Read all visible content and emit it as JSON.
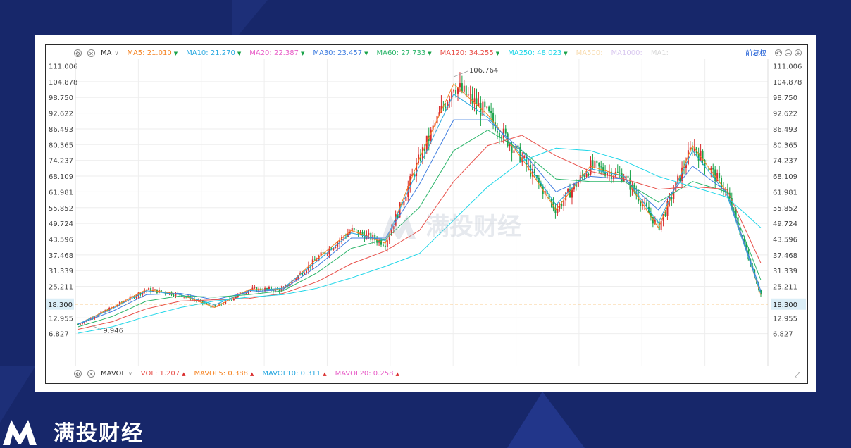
{
  "brand": {
    "name": "满投财经",
    "watermark": "满投财经"
  },
  "colors": {
    "background": "#17276a",
    "up": "#d92d2d",
    "down": "#1aa34a",
    "ref_line": "#f59a23"
  },
  "top_toolbar": {
    "settings_icon": "gear-icon",
    "close_icon": "close-icon",
    "indicator": "MA",
    "items": [
      {
        "name": "MA5:",
        "value": "21.010",
        "dir": "down",
        "color": "#f58220"
      },
      {
        "name": "MA10:",
        "value": "21.270",
        "dir": "down",
        "color": "#29a8e0"
      },
      {
        "name": "MA20:",
        "value": "22.387",
        "dir": "down",
        "color": "#e85fc8"
      },
      {
        "name": "MA30:",
        "value": "23.457",
        "dir": "down",
        "color": "#3f7de0"
      },
      {
        "name": "MA60:",
        "value": "27.733",
        "dir": "down",
        "color": "#2bb56a"
      },
      {
        "name": "MA120:",
        "value": "34.255",
        "dir": "down",
        "color": "#e8504a"
      },
      {
        "name": "MA250:",
        "value": "48.023",
        "dir": "down",
        "color": "#1fd6e8"
      },
      {
        "name": "MA500:",
        "value": "",
        "dir": "",
        "color": "#f8dcb0"
      },
      {
        "name": "MA1000:",
        "value": "",
        "dir": "",
        "color": "#d9c8f0"
      },
      {
        "name": "MA1:",
        "value": "",
        "dir": "",
        "color": "#d8d8d8"
      }
    ],
    "adjust_label": "前复权"
  },
  "bottom_toolbar": {
    "settings_icon": "gear-icon",
    "close_icon": "close-icon",
    "indicator": "MAVOL",
    "items": [
      {
        "name": "VOL:",
        "value": "1.207",
        "dir": "up",
        "color": "#e8504a"
      },
      {
        "name": "MAVOL5:",
        "value": "0.388",
        "dir": "up",
        "color": "#f58220"
      },
      {
        "name": "MAVOL10:",
        "value": "0.311",
        "dir": "up",
        "color": "#29a8e0"
      },
      {
        "name": "MAVOL20:",
        "value": "0.258",
        "dir": "up",
        "color": "#e85fc8"
      }
    ]
  },
  "chart_data": {
    "type": "line",
    "title": "",
    "xlabel": "",
    "ylabel": "",
    "ylim": [
      0.7,
      111.006
    ],
    "yticks": [
      "111.006",
      "104.878",
      "98.750",
      "92.622",
      "86.493",
      "80.365",
      "74.237",
      "68.109",
      "61.981",
      "55.852",
      "49.724",
      "43.596",
      "37.468",
      "31.339",
      "25.211",
      "18.300",
      "12.955",
      "6.827"
    ],
    "current_price": "18.300",
    "annotations": [
      {
        "label": "106.764",
        "value": 106.764,
        "kind": "high"
      },
      {
        "label": "9.946",
        "value": 9.946,
        "kind": "low"
      }
    ],
    "grid": true,
    "candles": "dense OHLC series with red (up) / green (down) bodies",
    "x": [
      0,
      5,
      10,
      15,
      20,
      25,
      30,
      35,
      40,
      45,
      50,
      55,
      60,
      65,
      70,
      75,
      80,
      85,
      90,
      95,
      100
    ],
    "series": [
      {
        "name": "MA5",
        "values": [
          10.5,
          17,
          24,
          22,
          17,
          24,
          24,
          36,
          47,
          42,
          75,
          104,
          92,
          75,
          55,
          72,
          68,
          48,
          80,
          62,
          22
        ]
      },
      {
        "name": "MA10",
        "values": [
          10.6,
          16.5,
          23.5,
          22,
          18,
          23.5,
          24.5,
          35,
          46,
          43,
          72,
          100,
          91,
          76,
          57,
          71,
          68,
          50,
          78,
          61,
          22.5
        ]
      },
      {
        "name": "MA30",
        "values": [
          10.5,
          15.5,
          22,
          22.5,
          20,
          23,
          24,
          33,
          44,
          44,
          65,
          90,
          90,
          78,
          62,
          68,
          67,
          55,
          72,
          62,
          23.5
        ]
      },
      {
        "name": "MA60",
        "values": [
          9.5,
          13.5,
          19.5,
          21.5,
          21,
          22,
          23.5,
          30.5,
          40,
          43.5,
          56,
          78,
          86,
          78,
          67,
          66,
          66,
          58,
          66,
          62,
          27.7
        ]
      },
      {
        "name": "MA120",
        "values": [
          8.5,
          11.5,
          16.5,
          19.5,
          20,
          20.5,
          22.5,
          27,
          34,
          39,
          47,
          66,
          80,
          84,
          76,
          70,
          67,
          63,
          64,
          63,
          34.3
        ]
      },
      {
        "name": "MA250",
        "values": [
          7.0,
          9.5,
          13.5,
          17,
          19.5,
          21,
          22,
          24.5,
          28.5,
          33,
          38,
          51,
          64,
          74,
          79,
          78,
          74,
          68,
          64,
          60,
          48.0
        ]
      }
    ]
  }
}
